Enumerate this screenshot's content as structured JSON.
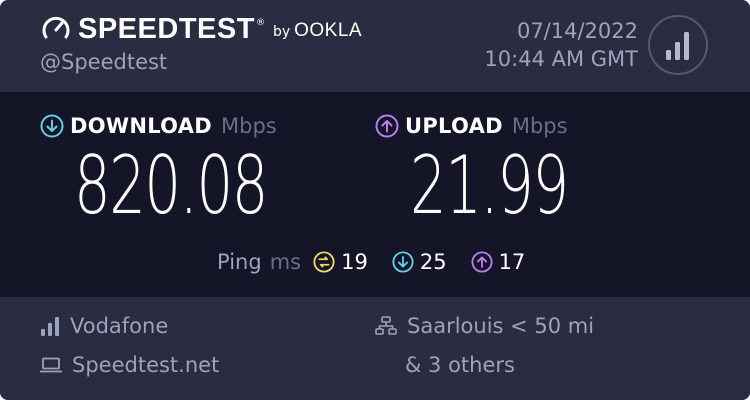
{
  "header": {
    "brand_name": "SPEEDTEST",
    "brand_reg": "®",
    "brand_by": "by",
    "brand_ookla": "OOKLA",
    "handle": "@Speedtest",
    "date": "07/14/2022",
    "time": "10:44 AM GMT"
  },
  "download": {
    "label": "DOWNLOAD",
    "unit": "Mbps",
    "value": "820.08"
  },
  "upload": {
    "label": "UPLOAD",
    "unit": "Mbps",
    "value": "21.99"
  },
  "ping": {
    "label": "Ping",
    "unit": "ms",
    "idle": "19",
    "download": "25",
    "upload": "17"
  },
  "footer": {
    "isp": "Vodafone",
    "host": "Speedtest.net",
    "server": "Saarlouis < 50 mi",
    "others": "& 3 others"
  },
  "colors": {
    "header_bg": "#2a2c41",
    "results_bg": "#141526",
    "download_accent": "#5fd0e6",
    "upload_accent": "#b77ff0",
    "ping_accent": "#f5d66b",
    "muted_text": "#9fa2bc"
  },
  "icons": [
    "gauge-icon",
    "signal-bars-icon",
    "download-arrow-icon",
    "upload-arrow-icon",
    "ping-idle-icon",
    "laptop-icon",
    "server-icon"
  ]
}
